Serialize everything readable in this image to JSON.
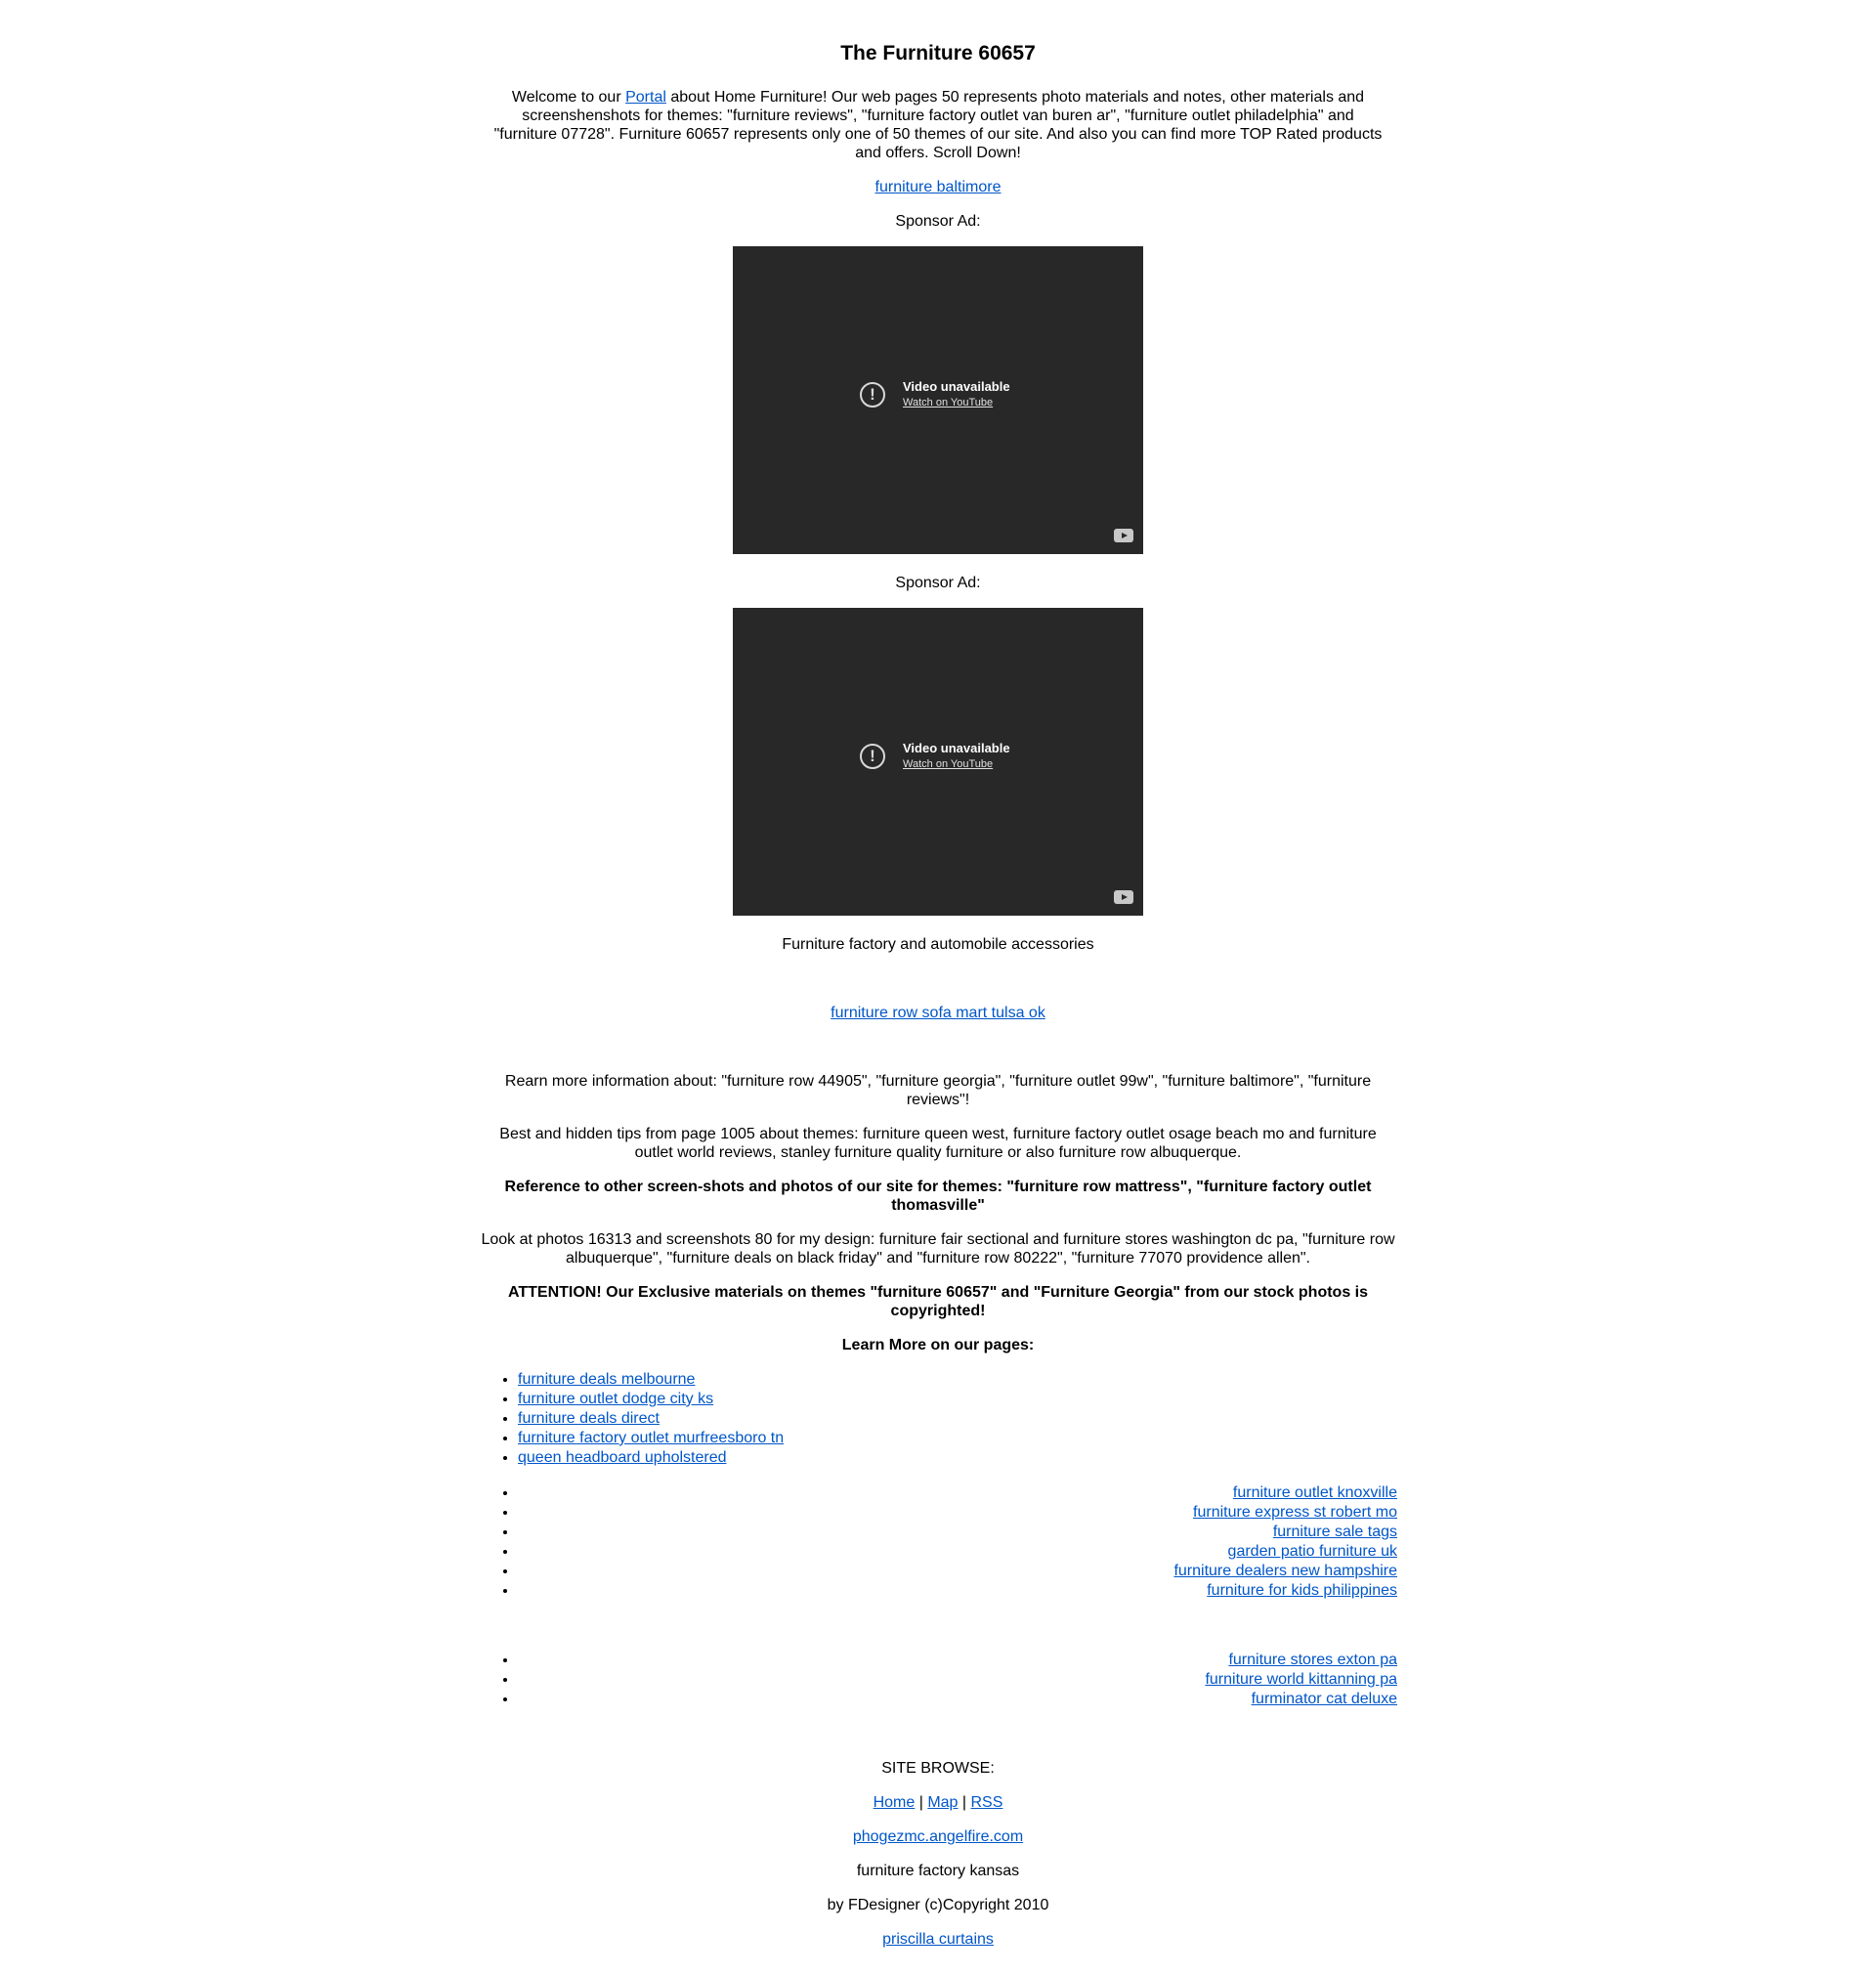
{
  "page": {
    "title": "The Furniture 60657",
    "intro": {
      "prefix": "Welcome to our ",
      "portal_link": "Portal",
      "suffix": " about Home Furniture! Our web pages 50 represents photo materials and notes, other materials and screenshenshots for themes: \"furniture reviews\", \"furniture factory outlet van buren ar\", \"furniture outlet philadelphia\" and \"furniture 07728\". Furniture 60657 represents only one of 50 themes of our site. And also you can find more TOP Rated products and offers. Scroll Down!"
    },
    "top_link": "furniture baltimore",
    "sponsor_label_1": "Sponsor Ad:",
    "sponsor_label_2": "Sponsor Ad:",
    "video_1": {
      "title": "Video unavailable",
      "link": "Watch on YouTube"
    },
    "video_2": {
      "title": "Video unavailable",
      "link": "Watch on YouTube"
    },
    "caption": "Furniture factory and automobile accessories",
    "mid_link": "furniture row sofa mart tulsa ok",
    "paragraphs": {
      "rearn": "Rearn more information about: \"furniture row 44905\", \"furniture georgia\", \"furniture outlet 99w\", \"furniture baltimore\", \"furniture reviews\"!",
      "tips": "Best and hidden tips from page 1005 about themes: furniture queen west, furniture factory outlet osage beach mo and furniture outlet world reviews, stanley furniture quality furniture or also furniture row albuquerque.",
      "reference": "Reference to other screen-shots and photos of our site for themes: \"furniture row mattress\", \"furniture factory outlet thomasville\"",
      "look": "Look at photos 16313 and screenshots 80 for my design: furniture fair sectional and furniture stores washington dc pa, \"furniture row albuquerque\", \"furniture deals on black friday\" and \"furniture row 80222\", \"furniture 77070 providence allen\".",
      "attention": "ATTENTION! Our Exclusive materials on themes \"furniture 60657\" and \"Furniture Georgia\" from our stock photos is copyrighted!",
      "learn_more": "Learn More on our pages:"
    },
    "list_left": [
      "furniture deals melbourne",
      "furniture outlet dodge city ks",
      "furniture deals direct",
      "furniture factory outlet murfreesboro tn",
      "queen headboard upholstered"
    ],
    "list_right_1": [
      "furniture outlet knoxville",
      "furniture express st robert mo",
      "furniture sale tags",
      "garden patio furniture uk",
      "furniture dealers new hampshire",
      "furniture for kids philippines"
    ],
    "list_right_2": [
      "furniture stores exton pa",
      "furniture world kittanning pa",
      "furminator cat deluxe"
    ],
    "footer": {
      "site_browse": "SITE BROWSE:",
      "nav": {
        "home": "Home",
        "sep1": " | ",
        "map": "Map",
        "sep2": " | ",
        "rss": "RSS"
      },
      "domain_link": "phogezmc.angelfire.com",
      "tagline": "furniture factory kansas",
      "copyright": "by FDesigner (c)Copyright 2010",
      "last_link": "priscilla curtains"
    }
  },
  "colors": {
    "link": "#0056c8",
    "video_bg": "#282828",
    "text": "#000000",
    "background": "#ffffff"
  },
  "icons": [
    "alert-circle-icon",
    "youtube-logo-icon"
  ]
}
